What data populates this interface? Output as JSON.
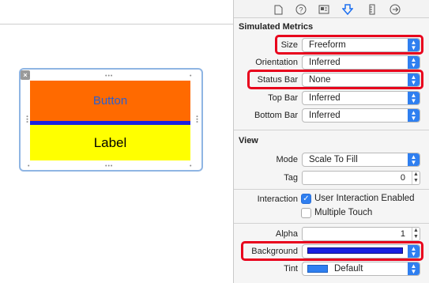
{
  "inspector": {
    "tabs": [
      {
        "name": "file-icon",
        "glyph": "▯"
      },
      {
        "name": "help-icon",
        "glyph": "?"
      },
      {
        "name": "identity-icon",
        "glyph": "▤"
      },
      {
        "name": "attributes-icon",
        "glyph": "⬇"
      },
      {
        "name": "size-icon",
        "glyph": "▮"
      },
      {
        "name": "connections-icon",
        "glyph": "→"
      }
    ],
    "simulated_metrics": {
      "title": "Simulated Metrics",
      "size": {
        "label": "Size",
        "value": "Freeform"
      },
      "orientation": {
        "label": "Orientation",
        "value": "Inferred"
      },
      "status_bar": {
        "label": "Status Bar",
        "value": "None"
      },
      "top_bar": {
        "label": "Top Bar",
        "value": "Inferred"
      },
      "bottom_bar": {
        "label": "Bottom Bar",
        "value": "Inferred"
      }
    },
    "view": {
      "title": "View",
      "mode": {
        "label": "Mode",
        "value": "Scale To Fill"
      },
      "tag": {
        "label": "Tag",
        "value": "0"
      },
      "interaction": {
        "label": "Interaction",
        "user_interaction": "User Interaction Enabled",
        "user_interaction_checked": true,
        "multiple_touch": "Multiple Touch",
        "multiple_touch_checked": false
      },
      "alpha": {
        "label": "Alpha",
        "value": "1"
      },
      "background": {
        "label": "Background",
        "color": "#1a21e0"
      },
      "tint": {
        "label": "Tint",
        "value": "Default",
        "color": "#2f7ff0"
      }
    }
  },
  "canvas": {
    "button_text": "Button",
    "label_text": "Label",
    "close_glyph": "×"
  },
  "colors": {
    "button_bg": "#ff6a00",
    "bar": "#1a21e0",
    "label_bg": "#ffff00",
    "highlight": "#e8001c",
    "accent": "#2f7ff0"
  }
}
